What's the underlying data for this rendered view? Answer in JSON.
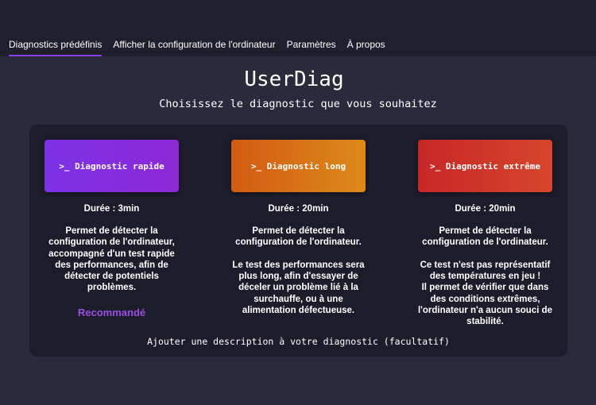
{
  "nav": {
    "tabs": [
      {
        "label": "Diagnostics prédéfinis",
        "active": true
      },
      {
        "label": "Afficher la configuration de l'ordinateur",
        "active": false
      },
      {
        "label": "Paramètres",
        "active": false
      },
      {
        "label": "À propos",
        "active": false
      }
    ]
  },
  "header": {
    "title": "UserDiag",
    "subtitle": "Choisissez le diagnostic que vous souhaitez"
  },
  "cards": [
    {
      "button_label": ">_ Diagnostic rapide",
      "duration": "Durée : 3min",
      "description": "Permet de détecter la\nconfiguration de l'ordinateur,\naccompagné d'un test rapide\ndes performances, afin de\ndétecter de potentiels\nproblèmes.",
      "badge": "Recommandé"
    },
    {
      "button_label": ">_ Diagnostic long",
      "duration": "Durée : 20min",
      "description": "Permet de détecter la\nconfiguration de l'ordinateur.\n\nLe test des performances sera\nplus long, afin d'essayer de\ndéceler un problème lié à la\nsurchauffe, ou à une\nalimentation défectueuse."
    },
    {
      "button_label": ">_ Diagnostic extrême",
      "duration": "Durée : 20min",
      "description": "Permet de détecter la\nconfiguration de l'ordinateur.\n\nCe test n'est pas représentatif\ndes températures en jeu !\nIl permet de vérifier que dans\ndes conditions extrêmes,\nl'ordinateur n'a aucun souci de\nstabilité."
    }
  ],
  "footer": {
    "link": "Ajouter une description à votre diagnostic (facultatif)"
  },
  "colors": {
    "background": "#292a3b",
    "panel": "#1c1c2b",
    "accent_purple": "#8b3fe6",
    "accent_orange": "#d8741a",
    "accent_red": "#c93328"
  }
}
